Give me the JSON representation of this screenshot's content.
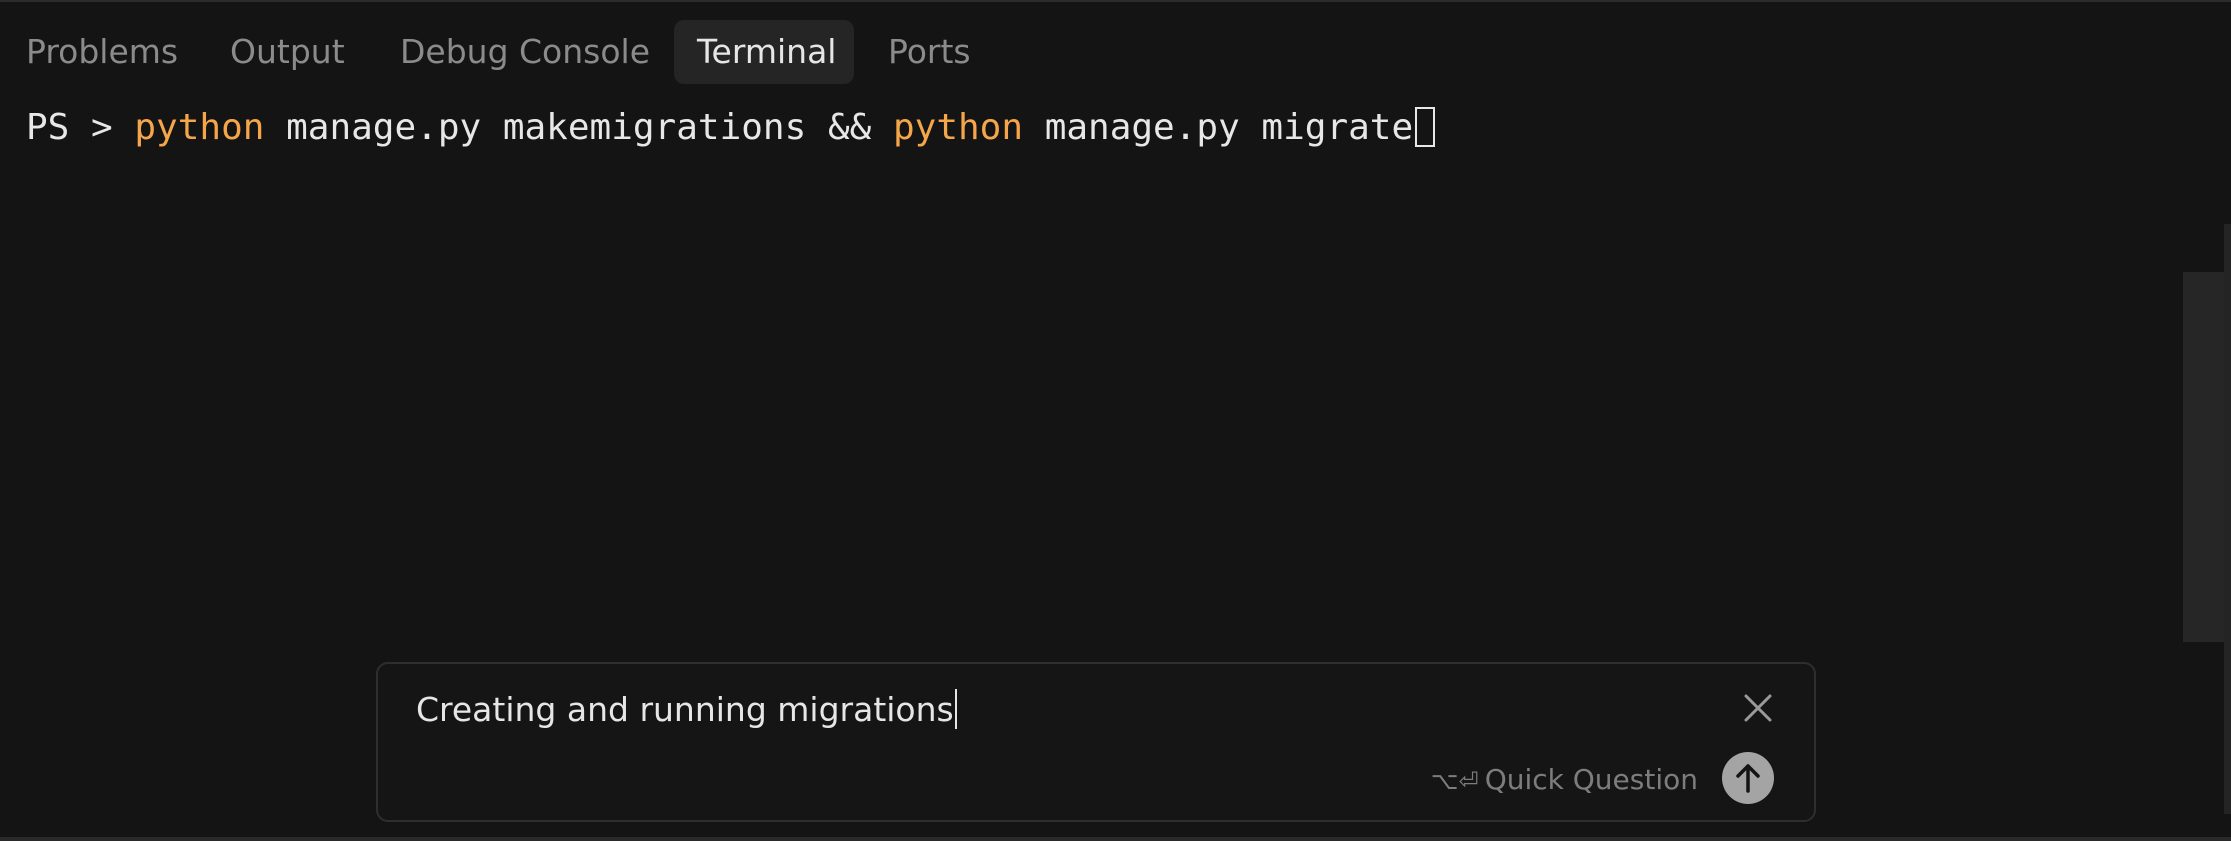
{
  "tabs": [
    {
      "label": "Problems",
      "active": false
    },
    {
      "label": "Output",
      "active": false
    },
    {
      "label": "Debug Console",
      "active": false
    },
    {
      "label": "Terminal",
      "active": true
    },
    {
      "label": "Ports",
      "active": false
    }
  ],
  "terminal": {
    "prompt": "PS > ",
    "cmd1": "python",
    "args1": " manage.py makemigrations && ",
    "cmd2": "python",
    "args2": " manage.py migrate"
  },
  "chat": {
    "input_value": "Creating and running migrations",
    "shortcut": "⌥⏎",
    "quick_question_label": "Quick Question"
  },
  "icons": {
    "close": "close-icon",
    "send": "arrow-up-icon"
  },
  "colors": {
    "background": "#141414",
    "keyword": "#f5a54a",
    "text": "#e7e7e7",
    "muted": "#8b8b8b",
    "active_tab_bg": "#252525",
    "send_button": "#a4a4a4"
  }
}
